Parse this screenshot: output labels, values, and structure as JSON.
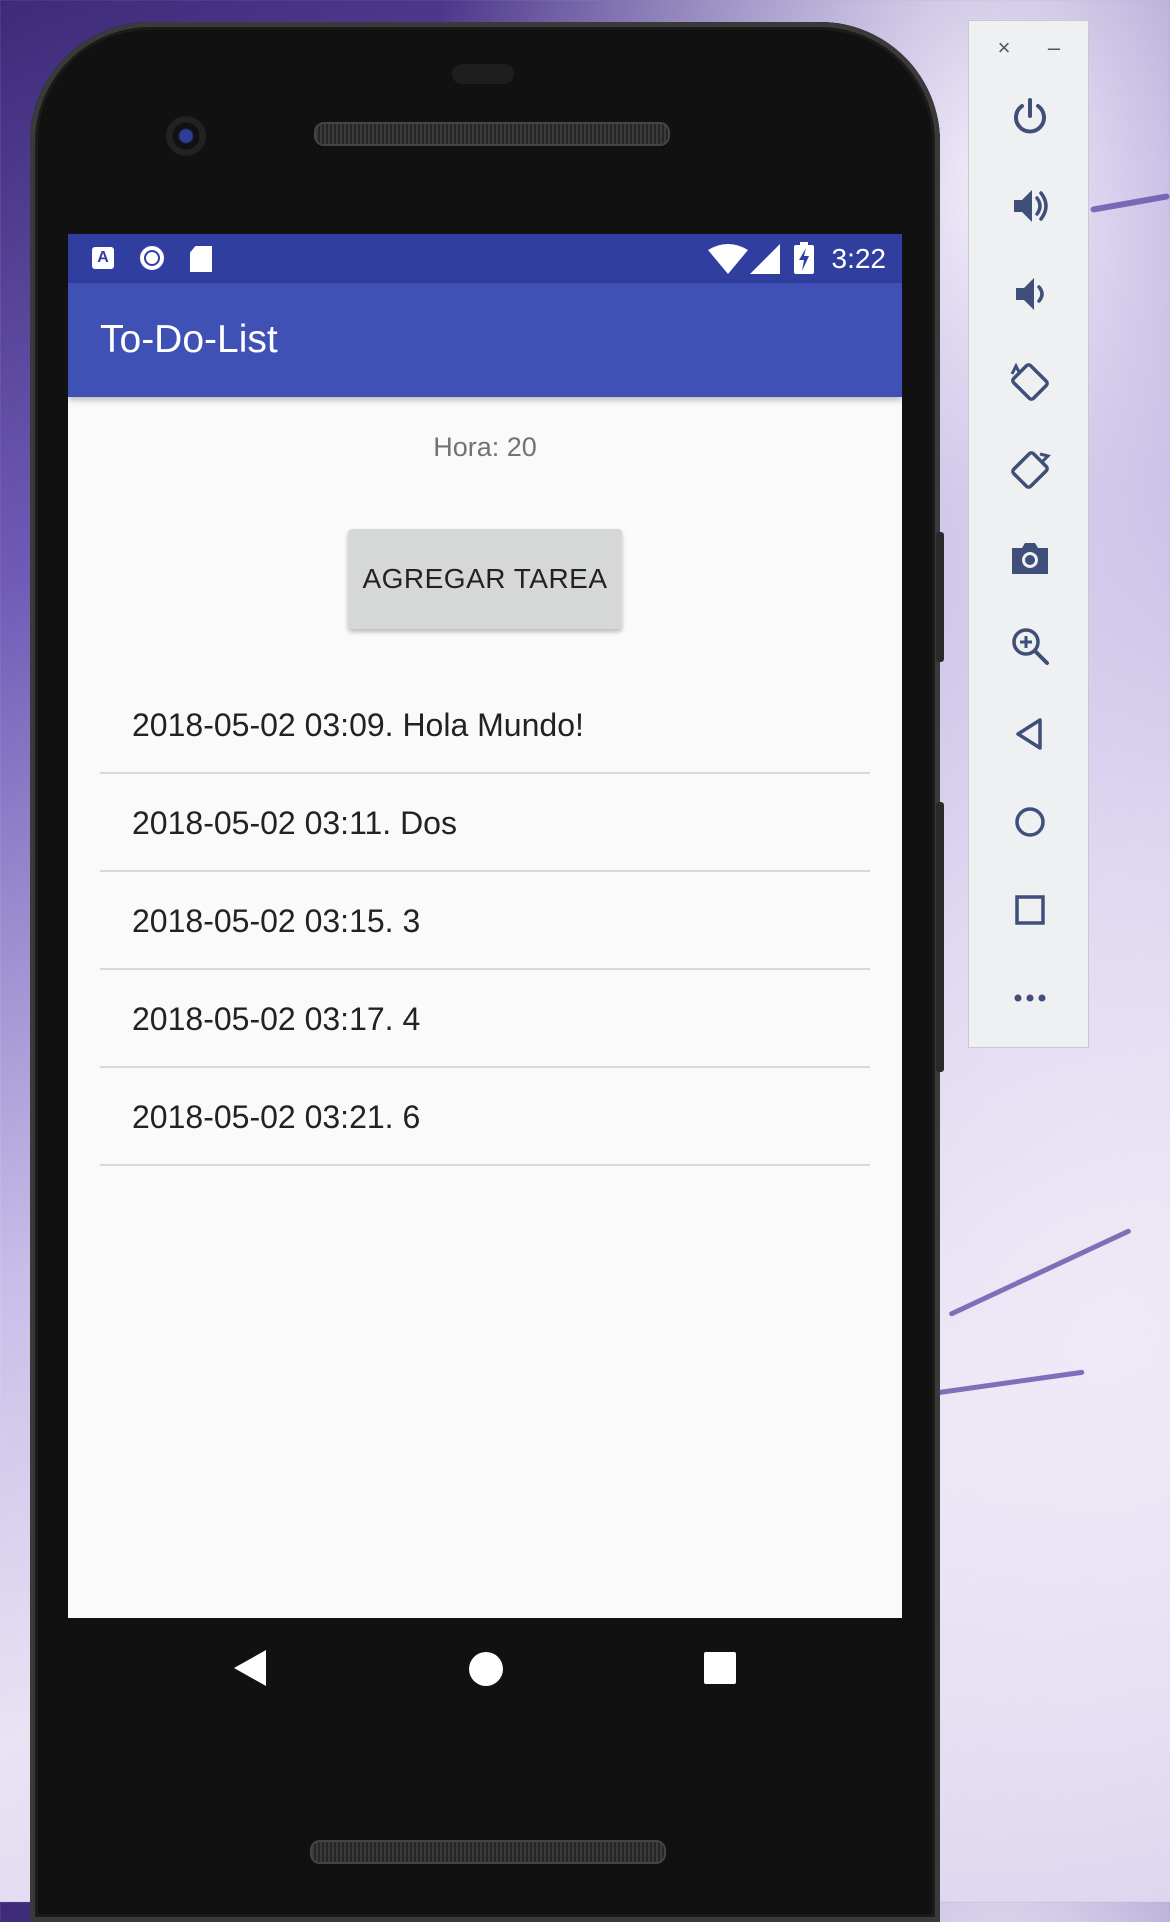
{
  "statusbar": {
    "time": "3:22",
    "notification_icon_letter": "A"
  },
  "appbar": {
    "title": "To-Do-List"
  },
  "main": {
    "hora": "Hora: 20",
    "add_button": "AGREGAR TAREA",
    "tasks": [
      "2018-05-02 03:09. Hola Mundo!",
      "2018-05-02 03:11. Dos",
      "2018-05-02 03:15. 3",
      "2018-05-02 03:17. 4",
      "2018-05-02 03:21. 6"
    ]
  },
  "emulator": {
    "close": "×",
    "minimize": "–",
    "tools": [
      "power-icon",
      "volume-up-icon",
      "volume-down-icon",
      "rotate-left-icon",
      "rotate-right-icon",
      "camera-icon",
      "zoom-icon",
      "back-icon",
      "home-icon",
      "overview-icon",
      "more-icon"
    ]
  },
  "colors": {
    "statusbar": "#303f9f",
    "appbar": "#3f51b5",
    "screen_bg": "#fafafa",
    "button": "#d6d7d7"
  }
}
